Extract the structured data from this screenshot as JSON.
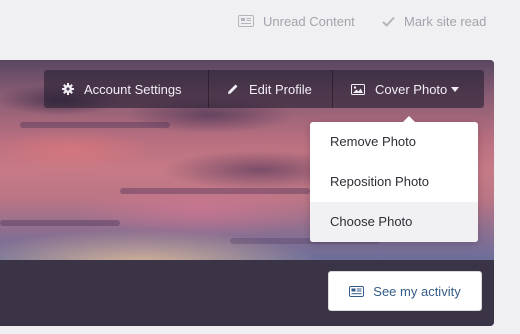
{
  "topbar": {
    "unread_label": "Unread Content",
    "mark_read_label": "Mark site read",
    "unread_icon": "newspaper-icon",
    "mark_read_icon": "check-icon"
  },
  "profile_header": {
    "buttons": {
      "account_settings": "Account Settings",
      "edit_profile": "Edit Profile",
      "cover_photo": "Cover Photo"
    },
    "icons": [
      "gear-icon",
      "pencil-icon",
      "image-icon",
      "caret-down-icon"
    ]
  },
  "cover_menu": {
    "items": [
      {
        "label": "Remove Photo"
      },
      {
        "label": "Reposition Photo"
      },
      {
        "label": "Choose Photo",
        "hovered": true
      }
    ]
  },
  "activity_button": {
    "label": "See my activity",
    "icon": "newspaper-icon"
  },
  "colors": {
    "page_bg": "#f0f0f2",
    "header_dark": "#3b3346",
    "topbar_text": "#a3a3ad",
    "link_blue": "#355c88",
    "menu_hover": "#f1f1f4"
  }
}
